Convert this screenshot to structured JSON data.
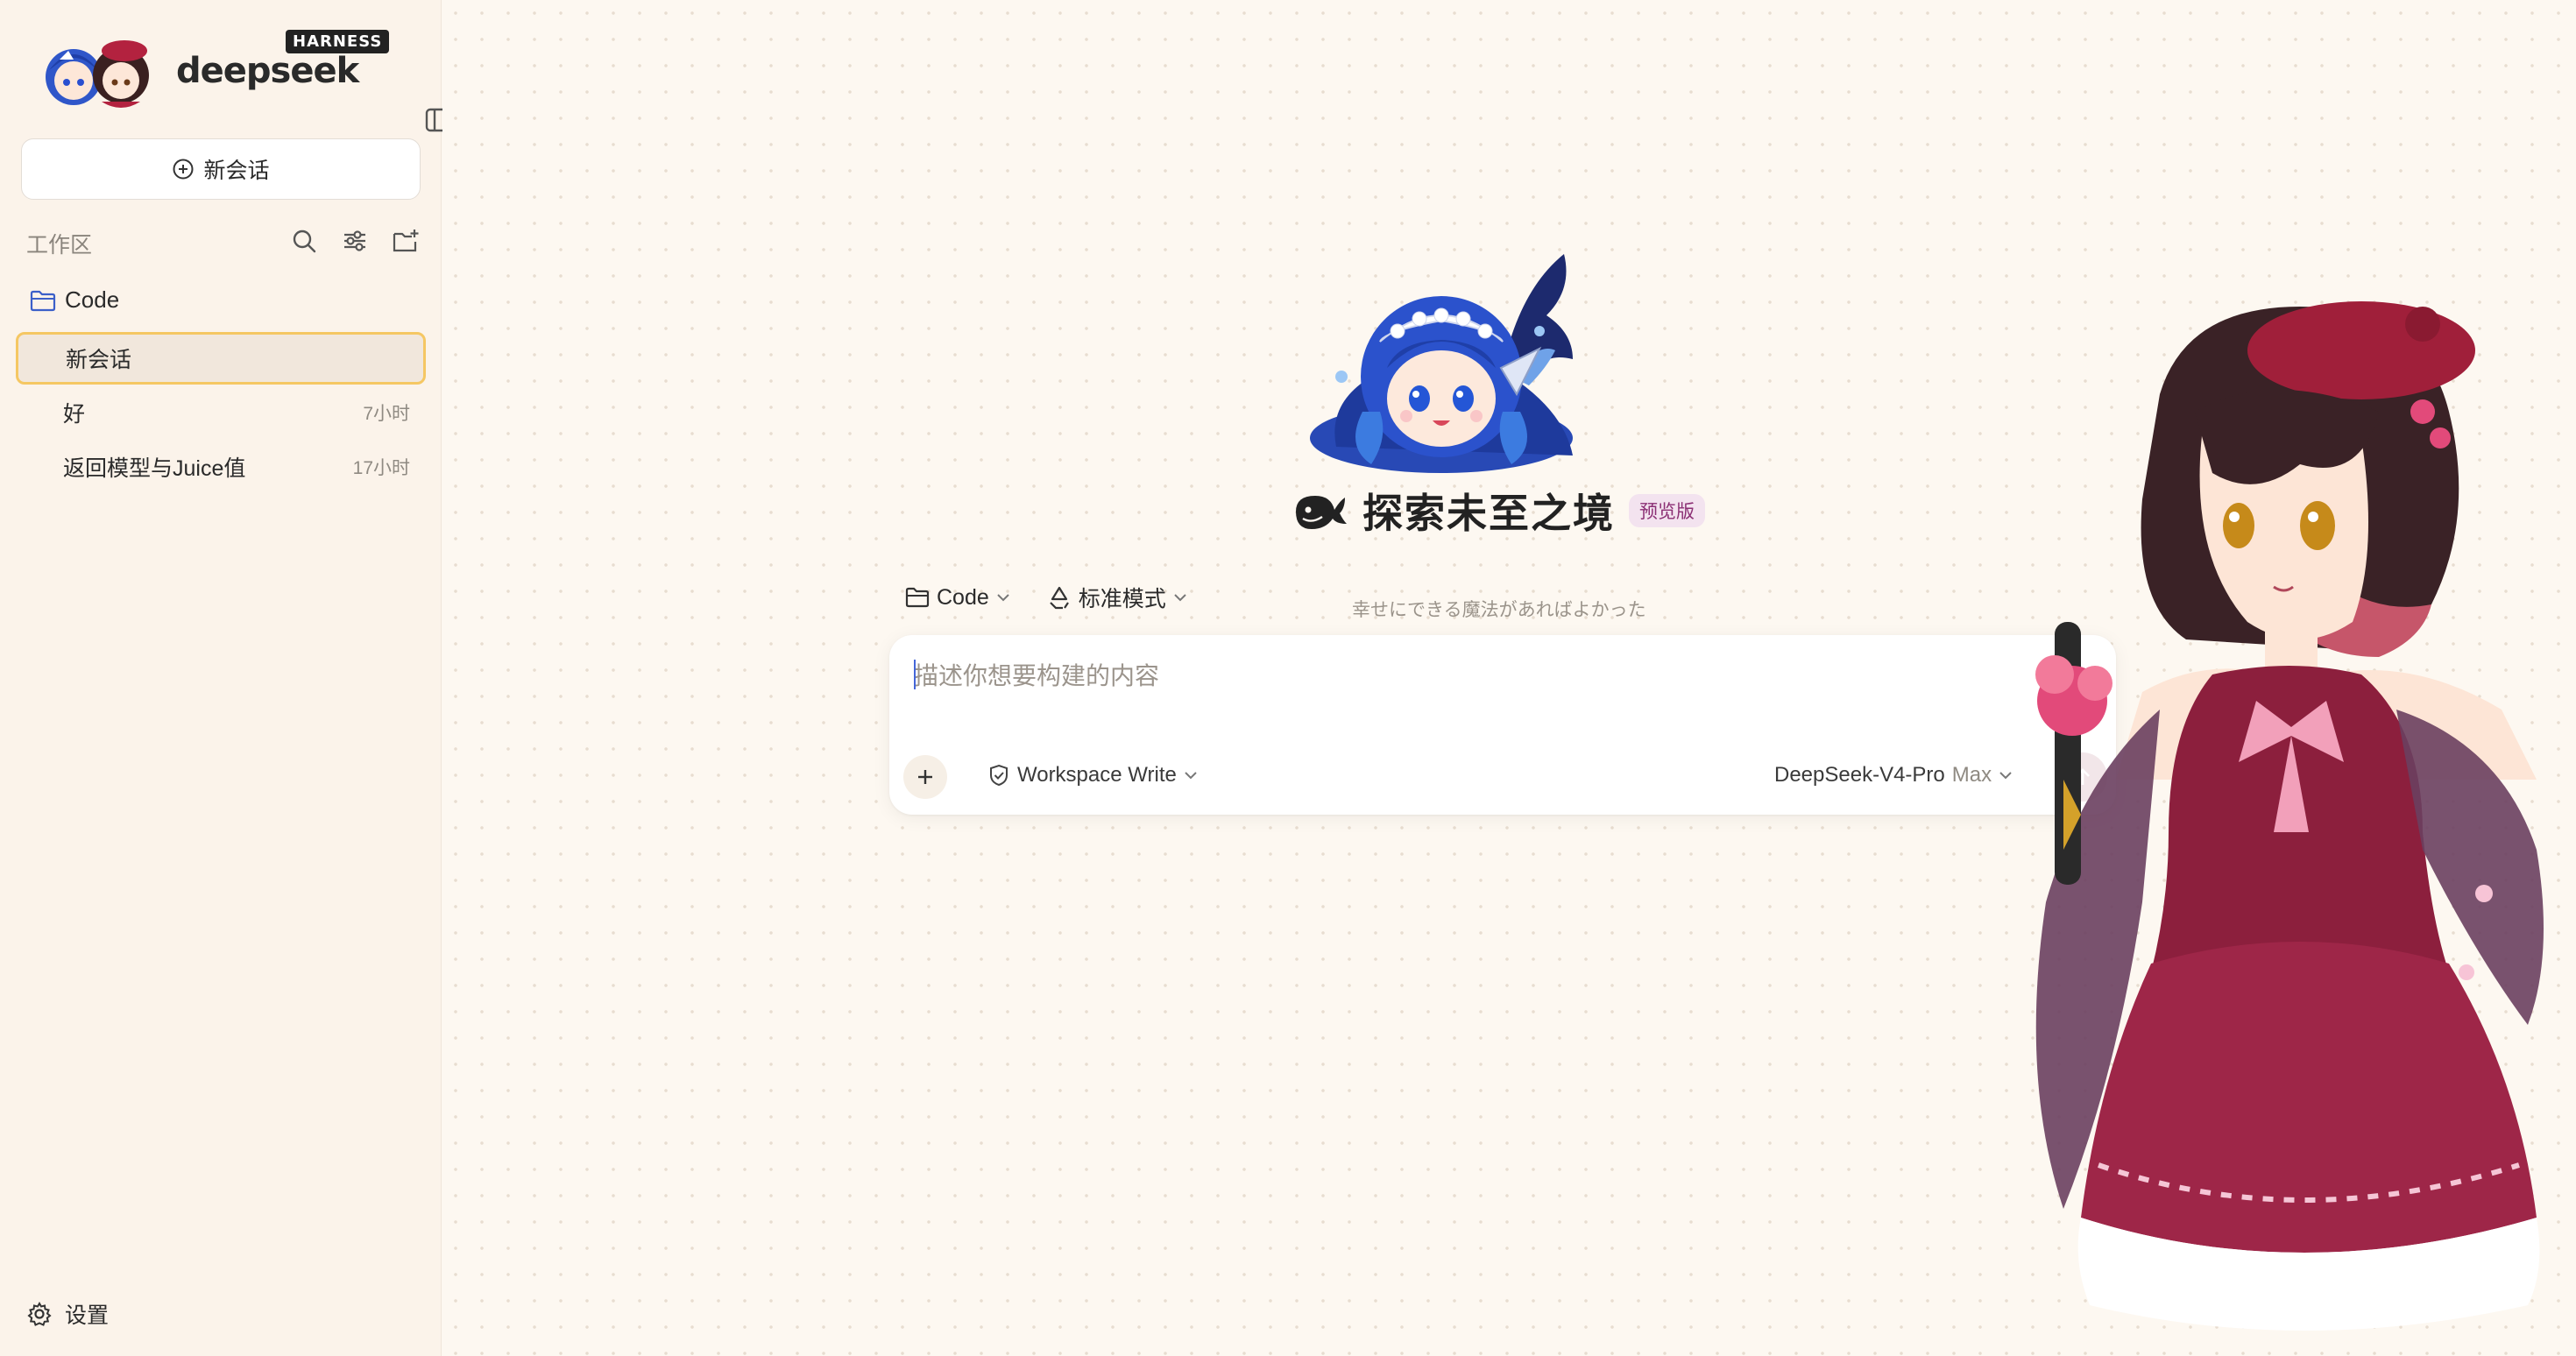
{
  "brand": {
    "wordmark": "deepseek",
    "badge": "HARNESS"
  },
  "sidebar": {
    "new_chat_label": "新会话",
    "workspace_label": "工作区",
    "folder": {
      "label": "Code"
    },
    "sessions": [
      {
        "title": "新会话",
        "time": "",
        "active": true
      },
      {
        "title": "好",
        "time": "7小时",
        "active": false
      },
      {
        "title": "返回模型与Juice值",
        "time": "17小时",
        "active": false
      }
    ],
    "settings_label": "设置"
  },
  "hero": {
    "title": "探索未至之境",
    "badge": "预览版",
    "tagline": "幸せにできる魔法があればよかった"
  },
  "composer": {
    "project_chip": "Code",
    "mode_chip": "标准模式",
    "placeholder": "描述你想要构建的内容",
    "value": "",
    "permission": "Workspace Write",
    "model": "DeepSeek-V4-Pro",
    "model_variant": "Max"
  },
  "icons": {
    "toggle": "sidebar-toggle-icon",
    "search": "search-icon",
    "filter": "sliders-icon",
    "new_folder": "folder-plus-icon",
    "folder": "folder-icon",
    "settings": "gear-icon",
    "send": "arrow-up-icon"
  },
  "colors": {
    "accent": "#f5c763",
    "sidebar_bg": "#fbf3ea",
    "main_bg": "#fdf8f1",
    "badge_purple": "#8b2f74",
    "folder_blue": "#3b5fc9"
  }
}
